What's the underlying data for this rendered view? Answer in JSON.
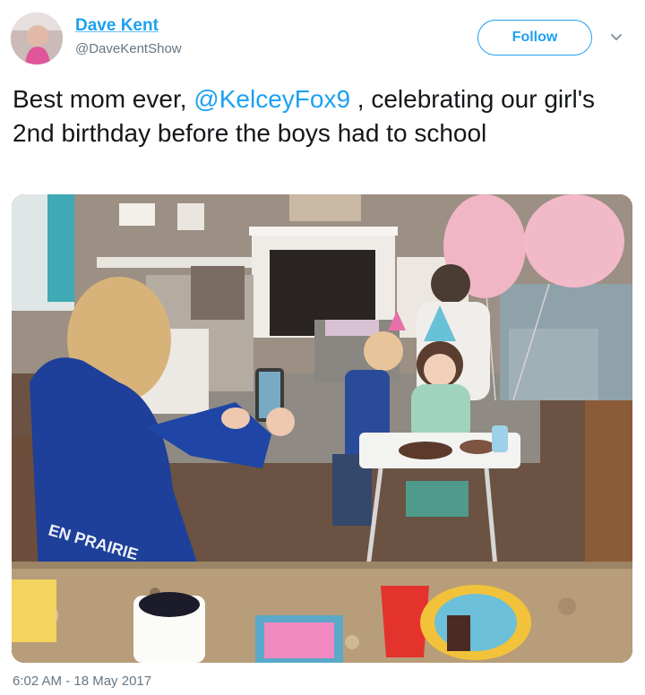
{
  "user": {
    "display_name": "Dave Kent",
    "handle": "@DaveKentShow"
  },
  "follow_button": {
    "label": "Follow"
  },
  "tweet": {
    "text_before": "Best mom ever, ",
    "mention": "@KelceyFox9",
    "text_after": " , celebrating our girl's 2nd birthday before the boys had to school"
  },
  "photo": {
    "shirt_text": "EN PRAIRIE"
  },
  "timestamp": "6:02 AM - 18 May 2017",
  "colors": {
    "accent": "#1da1f2",
    "muted": "#657786",
    "text": "#14171a"
  },
  "icons": {
    "more": "chevron-down-icon"
  }
}
